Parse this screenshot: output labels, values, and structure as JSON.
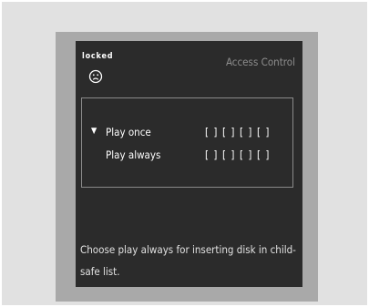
{
  "status": {
    "label": "locked",
    "icon": "sad-face-icon"
  },
  "title": "Access Control",
  "options": [
    {
      "label": "Play once",
      "selected": true,
      "slots": [
        "[ ]",
        "[ ]",
        "[ ]",
        "[ ]"
      ]
    },
    {
      "label": "Play always",
      "selected": false,
      "slots": [
        "[ ]",
        "[ ]",
        "[ ]",
        "[ ]"
      ]
    }
  ],
  "help_text": "Choose play always for inserting disk in child-safe list.",
  "colors": {
    "screen_bg": "#2b2b2b",
    "frame_bg": "#a9a9a9",
    "outer_bg": "#e1e1e1",
    "title_color": "#8e8e8e"
  }
}
